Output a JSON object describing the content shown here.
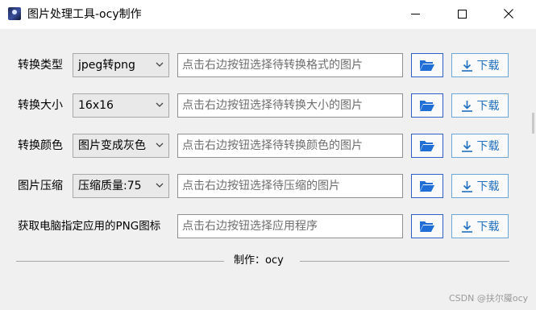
{
  "window": {
    "title": "图片处理工具-ocy制作",
    "icon": "app-icon"
  },
  "rows": [
    {
      "label": "转换类型",
      "select": "jpeg转png",
      "placeholder": "点击右边按钮选择待转换格式的图片",
      "download": "下载"
    },
    {
      "label": "转换大小",
      "select": "16x16",
      "placeholder": "点击右边按钮选择待转换大小的图片",
      "download": "下载"
    },
    {
      "label": "转换颜色",
      "select": "图片变成灰色",
      "placeholder": "点击右边按钮选择待转换颜色的图片",
      "download": "下载"
    },
    {
      "label": "图片压缩",
      "select": "压缩质量:75",
      "placeholder": "点击右边按钮选择待压缩的图片",
      "download": "下载"
    },
    {
      "label": "获取电脑指定应用的PNG图标",
      "placeholder": "点击右边按钮选择应用程序",
      "download": "下载"
    }
  ],
  "footer": {
    "text": "制作：ocy"
  },
  "watermark": "CSDN @扶尔魇ocy",
  "colors": {
    "folder_icon": "#1f6fd6",
    "download_text": "#1e6fc1",
    "folder_border": "#2e5ec8",
    "download_border": "#6aa7d8"
  }
}
